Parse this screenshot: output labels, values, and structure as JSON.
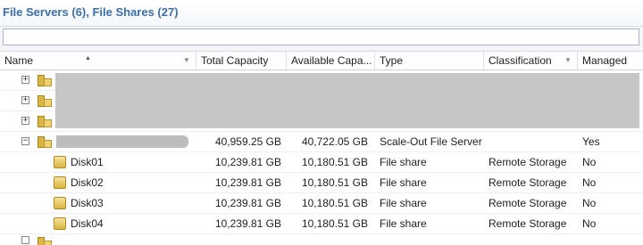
{
  "header_title": "File Servers (6), File Shares (27)",
  "filter": {
    "value": "",
    "placeholder": ""
  },
  "columns": [
    {
      "key": "name",
      "label": "Name"
    },
    {
      "key": "total",
      "label": "Total Capacity"
    },
    {
      "key": "available",
      "label": "Available Capa..."
    },
    {
      "key": "type",
      "label": "Type"
    },
    {
      "key": "classification",
      "label": "Classification"
    },
    {
      "key": "managed",
      "label": "Managed"
    }
  ],
  "sort": {
    "column": "name",
    "direction": "ascending"
  },
  "rows": [
    {
      "kind": "server",
      "expander": "+",
      "name": "",
      "total": "",
      "available": "",
      "type": "",
      "classification": "",
      "managed": "",
      "redacted": true
    },
    {
      "kind": "server",
      "expander": "+",
      "name": "",
      "total": "",
      "available": "",
      "type": "",
      "classification": "",
      "managed": "",
      "redacted": true
    },
    {
      "kind": "server",
      "expander": "+",
      "name": "",
      "total": "",
      "available": "",
      "type": "",
      "classification": "",
      "managed": "",
      "redacted": true
    },
    {
      "kind": "server",
      "expander": "−",
      "name": "",
      "total": "40,959.25 GB",
      "available": "40,722.05 GB",
      "type": "Scale-Out File Server",
      "classification": "",
      "managed": "Yes",
      "redacted": true
    },
    {
      "kind": "share",
      "name": "Disk01",
      "total": "10,239.81 GB",
      "available": "10,180.51 GB",
      "type": "File share",
      "classification": "Remote Storage",
      "managed": "No"
    },
    {
      "kind": "share",
      "name": "Disk02",
      "total": "10,239.81 GB",
      "available": "10,180.51 GB",
      "type": "File share",
      "classification": "Remote Storage",
      "managed": "No"
    },
    {
      "kind": "share",
      "name": "Disk03",
      "total": "10,239.81 GB",
      "available": "10,180.51 GB",
      "type": "File share",
      "classification": "Remote Storage",
      "managed": "No"
    },
    {
      "kind": "share",
      "name": "Disk04",
      "total": "10,239.81 GB",
      "available": "10,180.51 GB",
      "type": "File share",
      "classification": "Remote Storage",
      "managed": "No"
    }
  ],
  "icons": {
    "server": "file-server-icon",
    "share": "file-share-icon",
    "expand": "expand-icon",
    "collapse": "collapse-icon"
  },
  "colors": {
    "title": "#3c6fa8",
    "redaction": "#c6c6c6",
    "row_divider": "#eef0f3"
  }
}
